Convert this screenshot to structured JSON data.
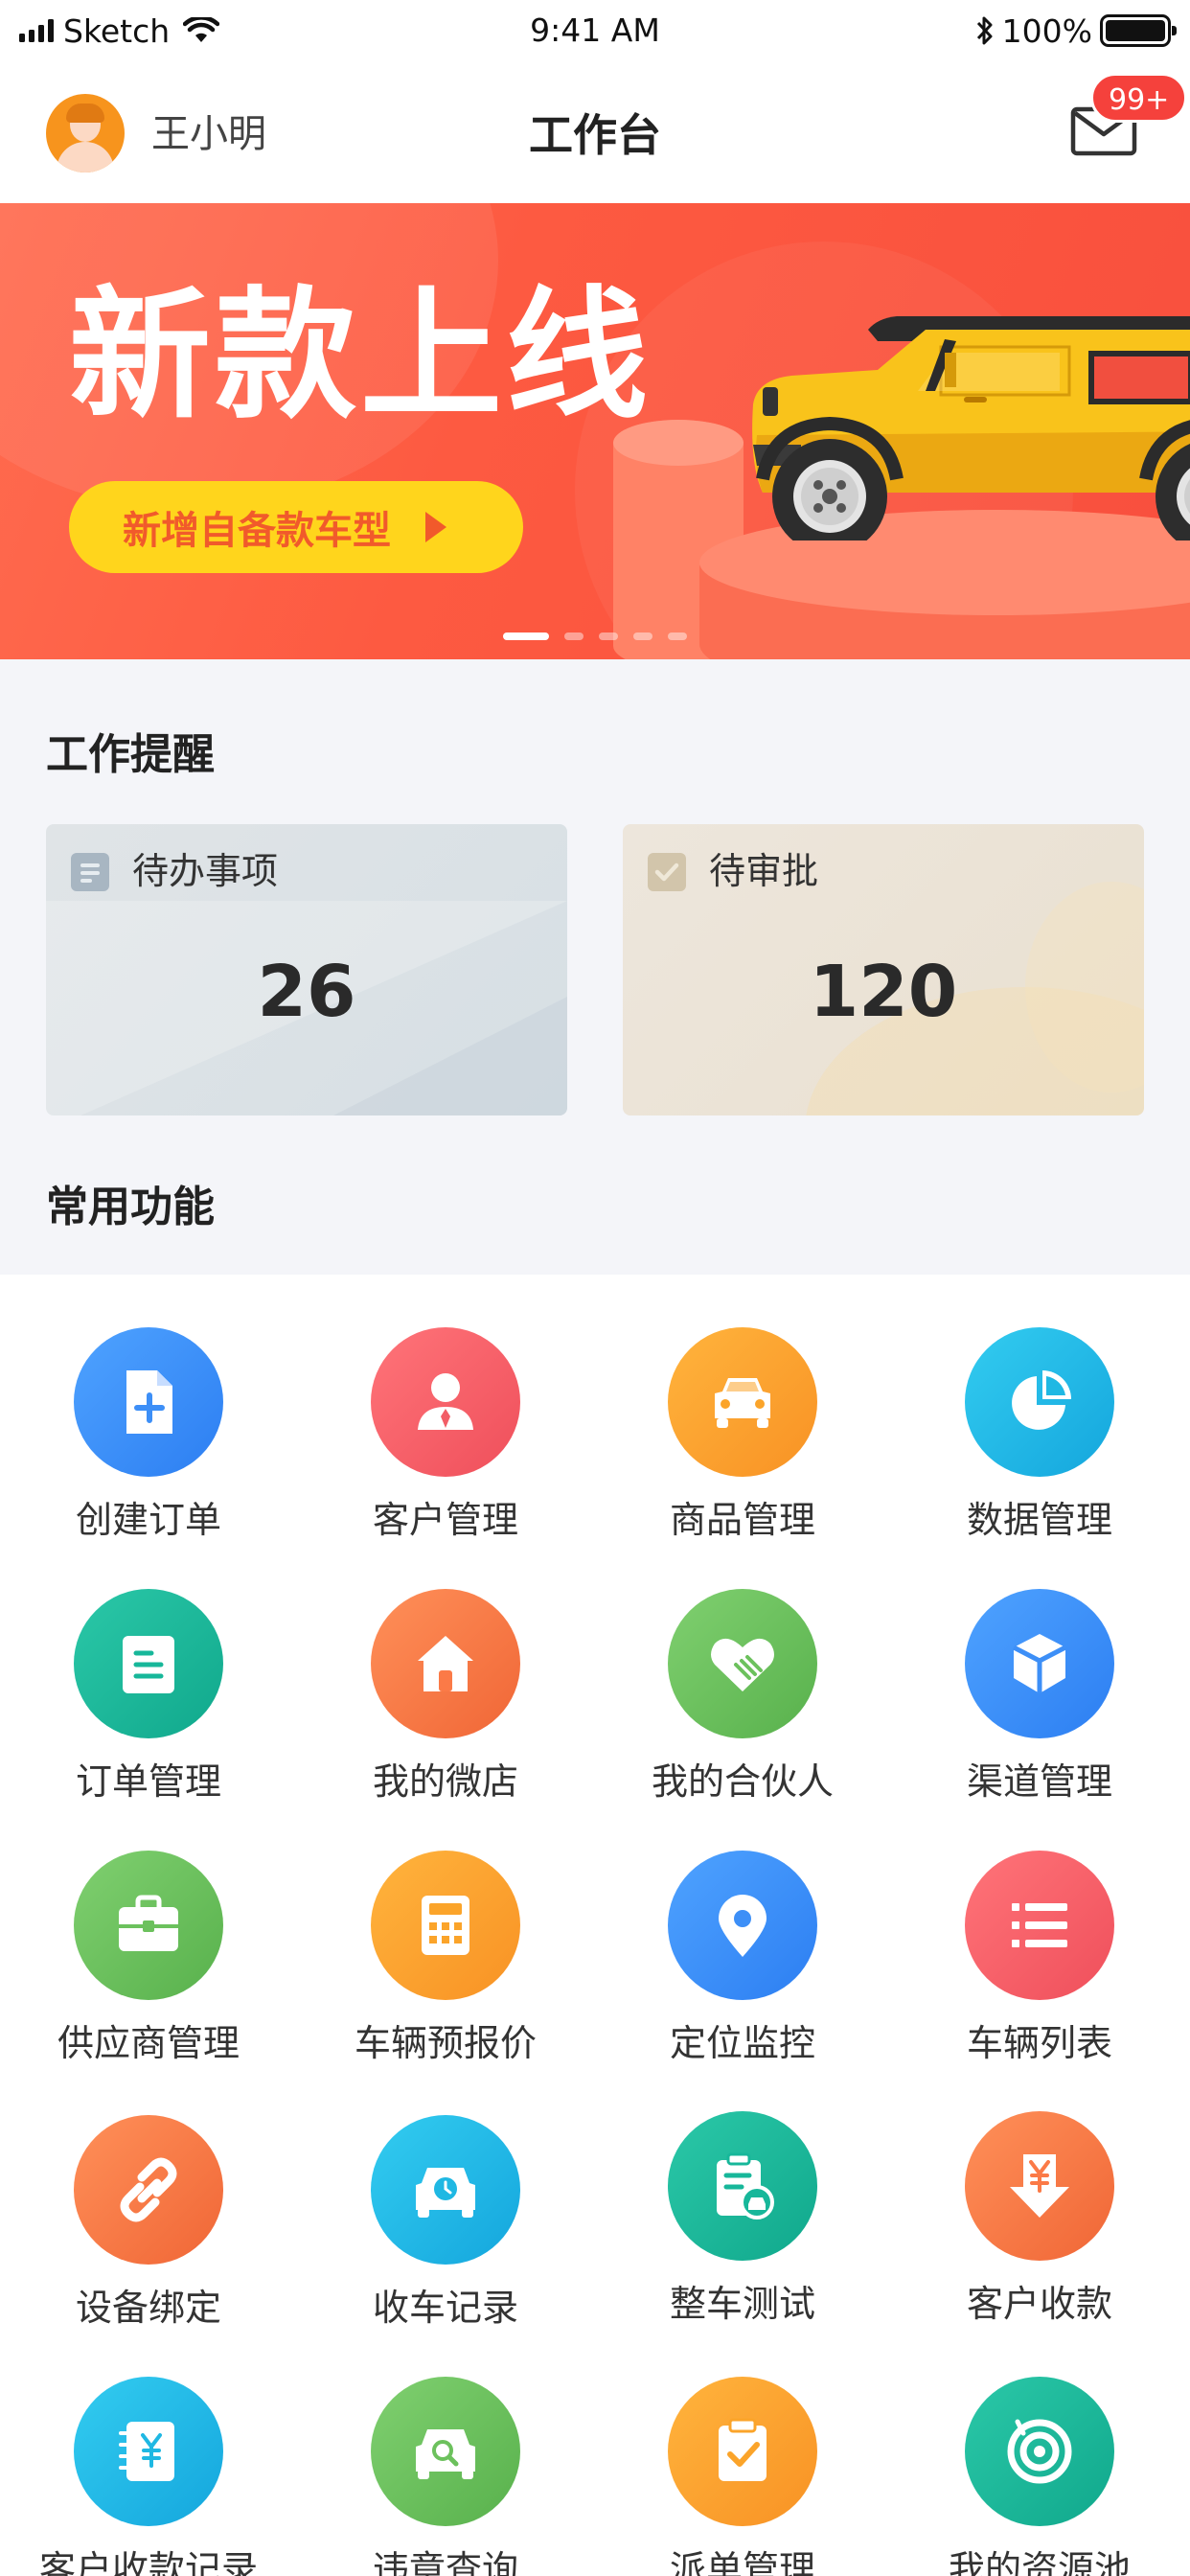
{
  "status_bar": {
    "carrier": "Sketch",
    "time": "9:41 AM",
    "battery": "100%"
  },
  "header": {
    "user_name": "王小明",
    "title": "工作台",
    "mail_badge": "99+"
  },
  "banner": {
    "title": "新款上线",
    "button": "新增自备款车型",
    "slide_count": 5,
    "active_slide": 1
  },
  "reminders": {
    "title": "工作提醒",
    "todo": {
      "label": "待办事项",
      "count": "26"
    },
    "approval": {
      "label": "待审批",
      "count": "120"
    }
  },
  "functions": {
    "title": "常用功能",
    "items": [
      {
        "label": "创建订单",
        "icon": "add-document-icon",
        "color": "#3d8ff7"
      },
      {
        "label": "客户管理",
        "icon": "person-icon",
        "color": "#f25d66"
      },
      {
        "label": "商品管理",
        "icon": "car-front-icon",
        "color": "#fba42a"
      },
      {
        "label": "数据管理",
        "icon": "pie-chart-icon",
        "color": "#1fb8e3"
      },
      {
        "label": "订单管理",
        "icon": "list-document-icon",
        "color": "#17b79a"
      },
      {
        "label": "我的微店",
        "icon": "home-icon",
        "color": "#fb7a47"
      },
      {
        "label": "我的合伙人",
        "icon": "handshake-heart-icon",
        "color": "#6cc15d"
      },
      {
        "label": "渠道管理",
        "icon": "cube-icon",
        "color": "#3d8ff7"
      },
      {
        "label": "供应商管理",
        "icon": "briefcase-icon",
        "color": "#6cc15d"
      },
      {
        "label": "车辆预报价",
        "icon": "calculator-icon",
        "color": "#fba42a"
      },
      {
        "label": "定位监控",
        "icon": "location-pin-icon",
        "color": "#3d8ff7"
      },
      {
        "label": "车辆列表",
        "icon": "list-icon",
        "color": "#f25d66"
      },
      {
        "label": "设备绑定",
        "icon": "link-icon",
        "color": "#fb7a47"
      },
      {
        "label": "收车记录",
        "icon": "car-clock-icon",
        "color": "#1fb8e3"
      },
      {
        "label": "整车测试",
        "icon": "clipboard-car-icon",
        "color": "#17b79a"
      },
      {
        "label": "客户收款",
        "icon": "yen-down-icon",
        "color": "#fb7a47"
      },
      {
        "label": "客户收款记录",
        "icon": "yen-notebook-icon",
        "color": "#1fb8e3"
      },
      {
        "label": "违章查询",
        "icon": "car-search-icon",
        "color": "#6cc15d"
      },
      {
        "label": "派单管理",
        "icon": "clipboard-check-icon",
        "color": "#fba42a"
      },
      {
        "label": "我的资源池",
        "icon": "target-icon",
        "color": "#17b79a"
      }
    ]
  }
}
